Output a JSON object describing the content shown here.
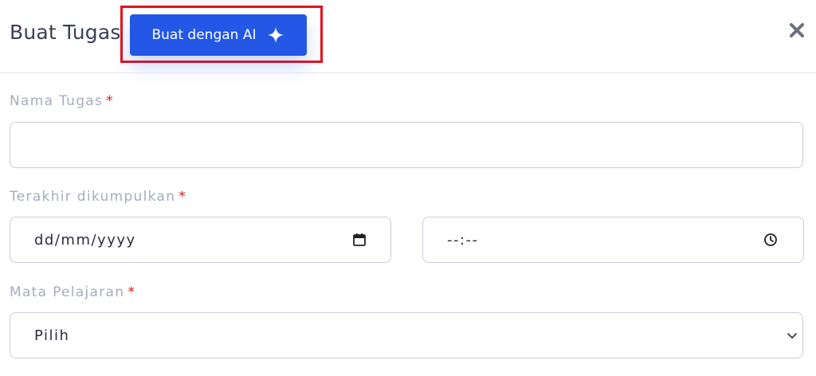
{
  "header": {
    "title": "Buat Tugas",
    "ai_button_label": "Buat dengan AI"
  },
  "form": {
    "task_name": {
      "label": "Nama Tugas",
      "required_mark": "*",
      "value": ""
    },
    "deadline": {
      "label": "Terakhir dikumpulkan",
      "required_mark": "*",
      "date_value": "dd/mm/yyyy",
      "time_value": "--:--"
    },
    "subject": {
      "label": "Mata Pelajaran",
      "required_mark": "*",
      "selected": "Pilih"
    }
  },
  "icons": {
    "sparkle": "sparkle-icon",
    "close": "close-icon",
    "calendar": "calendar-icon",
    "clock": "clock-icon",
    "chevron": "chevron-down-icon"
  },
  "colors": {
    "primary": "#2457e6",
    "highlight_box": "#e3121b",
    "required": "#e3121b",
    "label": "#a7acbd",
    "title": "#3a3f56"
  }
}
